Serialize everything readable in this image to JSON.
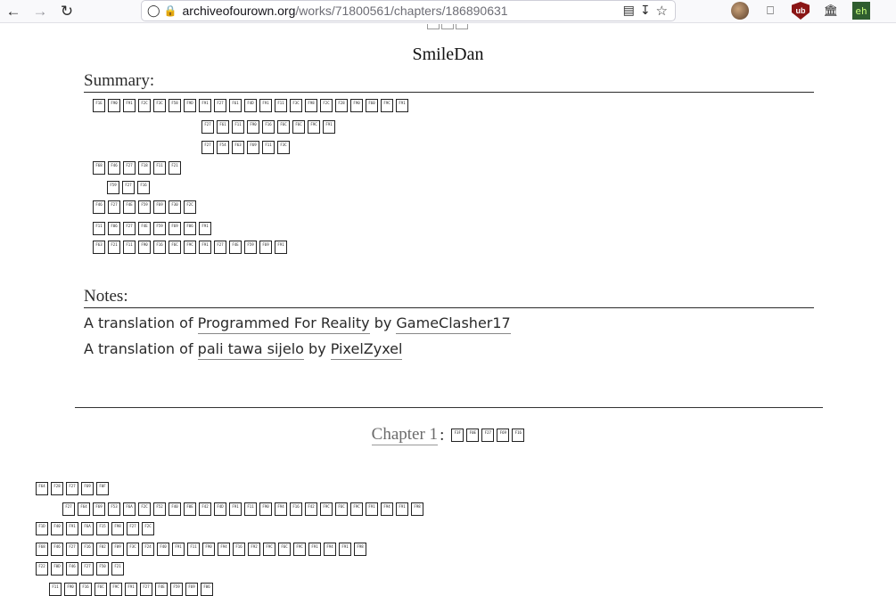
{
  "browser": {
    "url_host": "archiveofourown.org",
    "url_path": "/works/71800561/chapters/186890631",
    "icons": [
      "back-icon",
      "forward-icon",
      "reload-icon",
      "shield-icon",
      "lock-icon",
      "reader-icon",
      "download-icon",
      "bookmark-star-icon",
      "avatar-icon",
      "extensions-icon",
      "ublock-icon",
      "library-icon",
      "eh-icon"
    ],
    "ublock_label": "ub",
    "eh_label": "eh"
  },
  "work": {
    "author": "SmileDan",
    "summary_heading": "Summary:",
    "notes_heading": "Notes:",
    "notes": [
      {
        "prefix": "A translation of ",
        "work": "Programmed For Reality",
        "by": " by ",
        "author": "GameClasher17"
      },
      {
        "prefix": "A translation of ",
        "work": "pali tawa sijelo",
        "by": " by ",
        "author": "PixelZyxel"
      }
    ],
    "chapter_link": "Chapter 1",
    "chapter_sep": ":"
  },
  "tofu": {
    "summary_lines": [
      [
        "F1E",
        "F90",
        "F91",
        "F2C",
        "F3C",
        "F58",
        "F9D",
        "F91",
        "F27",
        "F61",
        "F4D",
        "F91",
        "F11",
        "F3C",
        "F98",
        "F2C",
        "F28",
        "F90",
        "F60",
        "F9C",
        "F91"
      ],
      [
        "F27",
        "F61",
        "F11",
        "F90",
        "F16",
        "F6C",
        "F6C",
        "F9C",
        "F91"
      ],
      [
        "F27",
        "F54",
        "F63",
        "F69",
        "F11",
        "F3C"
      ],
      [
        "F68",
        "F46",
        "F27",
        "F18",
        "F11",
        "F21"
      ],
      [
        "F59",
        "F27",
        "F16"
      ],
      [
        "F46",
        "F27",
        "F4E",
        "F59",
        "F69",
        "F30",
        "F2C"
      ],
      [
        "F11",
        "F06",
        "F27",
        "F4E",
        "F59",
        "F69",
        "F06",
        "F91"
      ],
      [
        "F63",
        "F21",
        "F11",
        "F90",
        "F16",
        "F6C",
        "F9C",
        "F91",
        "F27",
        "F4E",
        "F59",
        "F69",
        "F91"
      ]
    ],
    "chapter_title": [
      "F3F",
      "F0E",
      "F27",
      "F69",
      "F16"
    ],
    "body_lines": [
      [
        "F64",
        "F28",
        "F27",
        "F69",
        "F0F"
      ],
      [
        "F27",
        "F64",
        "F69",
        "F53",
        "F6A",
        "F2C",
        "F52",
        "F40",
        "F0E",
        "F42",
        "F4D",
        "F91",
        "F11",
        "F90",
        "F94",
        "F16",
        "F42",
        "F9C",
        "F6C",
        "F9C",
        "F91",
        "F94",
        "F91",
        "F98"
      ],
      [
        "F1D",
        "F40",
        "F91",
        "F6A",
        "F15",
        "F98",
        "F27",
        "F2C"
      ],
      [
        "F68",
        "F46",
        "F27",
        "F16",
        "F02",
        "F09",
        "F3C",
        "F24",
        "F40",
        "F91",
        "F11",
        "F90",
        "F94",
        "F16",
        "F92",
        "F9C",
        "F6C",
        "F9C",
        "F91",
        "F94",
        "F91",
        "F98"
      ],
      [
        "F22",
        "F0D",
        "F46",
        "F27",
        "F50",
        "F21"
      ],
      [
        "F11",
        "F90",
        "F16",
        "F6C",
        "F9C",
        "F91",
        "F27",
        "F4E",
        "F59",
        "F69",
        "F06"
      ]
    ]
  }
}
